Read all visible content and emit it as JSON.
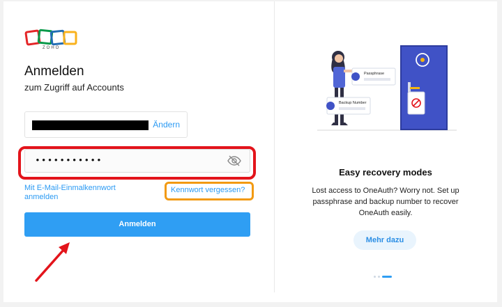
{
  "logo": {
    "wordmark": "ZOHO",
    "colors": [
      "#e42527",
      "#089949",
      "#226db4",
      "#f9b21d"
    ]
  },
  "signin": {
    "title": "Anmelden",
    "subtitle": "zum Zugriff auf Accounts",
    "email_change_label": "Ändern",
    "password_value": "•••••••••••",
    "otp_link": "Mit E-Mail-Einmalkennwort anmelden",
    "forgot_link": "Kennwort vergessen?",
    "submit_label": "Anmelden"
  },
  "recovery_panel": {
    "illustration_labels": {
      "passphrase": "Passphrase",
      "backup_number": "Backup Number"
    },
    "title": "Easy recovery modes",
    "description": "Lost access to OneAuth? Worry not. Set up passphrase and backup number to recover OneAuth easily.",
    "more_label": "Mehr dazu",
    "carousel_active_index": 2,
    "carousel_count": 3
  },
  "annotations": {
    "highlight_password": "#e3141b",
    "highlight_forgot": "#f29a12",
    "arrow": "#e3141b"
  },
  "icons": [
    "eye-slash-icon",
    "zoho-logo"
  ]
}
